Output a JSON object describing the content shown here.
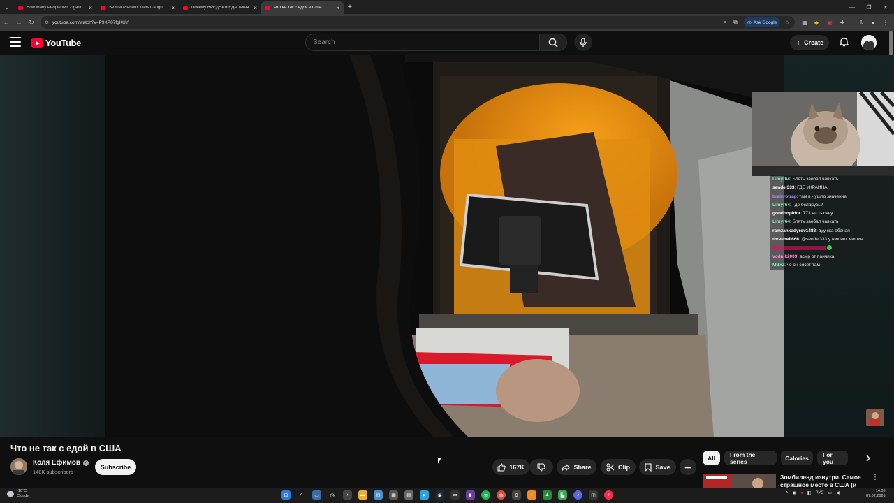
{
  "browser": {
    "tabs": [
      {
        "title": "How Many People Will Zigant",
        "active": false
      },
      {
        "title": "Sexual Predator Gets Caught in",
        "active": false
      },
      {
        "title": "Почему ВРЕДНАЯ ЕДА такая",
        "active": false
      },
      {
        "title": "Что не так с едой в США",
        "active": true
      }
    ],
    "url": "youtube.com/watch?v=P9XP07fgKUY",
    "ask_google": "Ask Google"
  },
  "header": {
    "logo_text": "YouTube",
    "search_placeholder": "Search",
    "create_label": "Create"
  },
  "chat": [
    {
      "user": "Limyr64",
      "text": "Блять заебал чавкать",
      "color": "#7ee8c0"
    },
    {
      "user": "sendel333",
      "text": "ГДЕ УКРАИНА",
      "color": "#ffffff"
    },
    {
      "user": "brainrotrap",
      "text": "там в - ушло значение",
      "color": "#b388ff"
    },
    {
      "user": "Limyr64",
      "text": "Где беларусь?",
      "color": "#7ee8c0"
    },
    {
      "user": "gondonpidor",
      "text": "773 на тысячу",
      "color": "#ffffff"
    },
    {
      "user": "Limyr64",
      "text": "Блять заебал чавкать",
      "color": "#7ee8c0"
    },
    {
      "user": "ramzankadyrov1488",
      "text": "ауу ска ебаная",
      "color": "#ffffff"
    },
    {
      "user": "threehell666",
      "text": "@sendel333 у них нет машин",
      "color": "#ffffff"
    },
    {
      "user": "",
      "text": "",
      "color": "#e0115f"
    },
    {
      "user": "vodnik2009",
      "text": "асмр от пончика",
      "color": "#ff8ad8"
    },
    {
      "user": "MBxz",
      "text": "чё он сосёт там",
      "color": "#7ee8c0"
    }
  ],
  "video": {
    "title": "Что не так с едой в США",
    "channel": "Коля Ефимов",
    "subscribers": "148K subscribers",
    "subscribe_label": "Subscribe",
    "likes": "167K",
    "share_label": "Share",
    "clip_label": "Clip",
    "save_label": "Save"
  },
  "chips": [
    {
      "label": "All",
      "active": true
    },
    {
      "label": "From the series",
      "active": false
    },
    {
      "label": "Calories",
      "active": false
    },
    {
      "label": "For you",
      "active": false
    }
  ],
  "recommendation": {
    "title": "Зомбиленд изнутри. Самое страшное место в США (и в"
  },
  "taskbar": {
    "weather_temp": "-10°C",
    "weather_desc": "Cloudy",
    "language": "РУС",
    "time": "14:06",
    "date": "07.02.2026"
  }
}
